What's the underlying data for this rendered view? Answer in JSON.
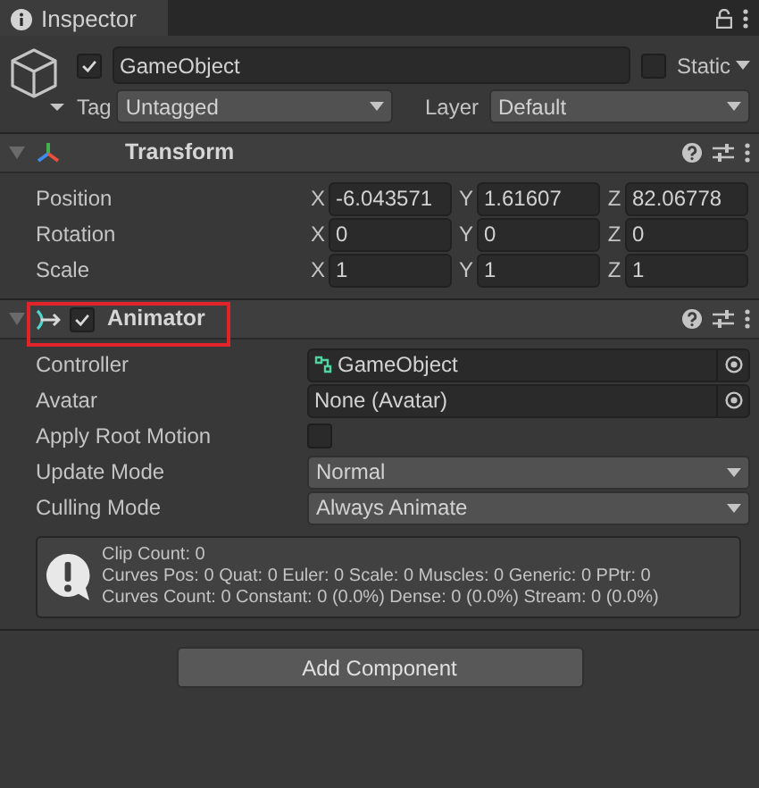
{
  "window": {
    "title": "Inspector"
  },
  "game_object": {
    "active": true,
    "name": "GameObject",
    "static": false,
    "static_label": "Static",
    "tag_label": "Tag",
    "tag": "Untagged",
    "layer_label": "Layer",
    "layer": "Default"
  },
  "components": [
    {
      "kind": "transform",
      "title": "Transform",
      "expanded": true,
      "rows": [
        {
          "label": "Position",
          "axes": [
            {
              "axis": "X",
              "value": "-6.043571"
            },
            {
              "axis": "Y",
              "value": "1.61607"
            },
            {
              "axis": "Z",
              "value": "82.06778"
            }
          ]
        },
        {
          "label": "Rotation",
          "axes": [
            {
              "axis": "X",
              "value": "0"
            },
            {
              "axis": "Y",
              "value": "0"
            },
            {
              "axis": "Z",
              "value": "0"
            }
          ]
        },
        {
          "label": "Scale",
          "axes": [
            {
              "axis": "X",
              "value": "1"
            },
            {
              "axis": "Y",
              "value": "1"
            },
            {
              "axis": "Z",
              "value": "1"
            }
          ]
        }
      ]
    },
    {
      "kind": "animator",
      "title": "Animator",
      "expanded": true,
      "enabled": true,
      "highlighted": true,
      "fields": [
        {
          "kind": "object",
          "label": "Controller",
          "value": "GameObject",
          "assigned": true
        },
        {
          "kind": "object",
          "label": "Avatar",
          "value": "None (Avatar)",
          "assigned": false
        },
        {
          "kind": "checkbox",
          "label": "Apply Root Motion",
          "checked": false
        },
        {
          "kind": "dropdown",
          "label": "Update Mode",
          "value": "Normal"
        },
        {
          "kind": "dropdown",
          "label": "Culling Mode",
          "value": "Always Animate"
        }
      ],
      "info": [
        "Clip Count: 0",
        "Curves Pos: 0 Quat: 0 Euler: 0 Scale: 0 Muscles: 0 Generic: 0 PPtr: 0",
        "Curves Count: 0 Constant: 0 (0.0%) Dense: 0 (0.0%) Stream: 0 (0.0%)"
      ]
    }
  ],
  "add_button": "Add Component"
}
